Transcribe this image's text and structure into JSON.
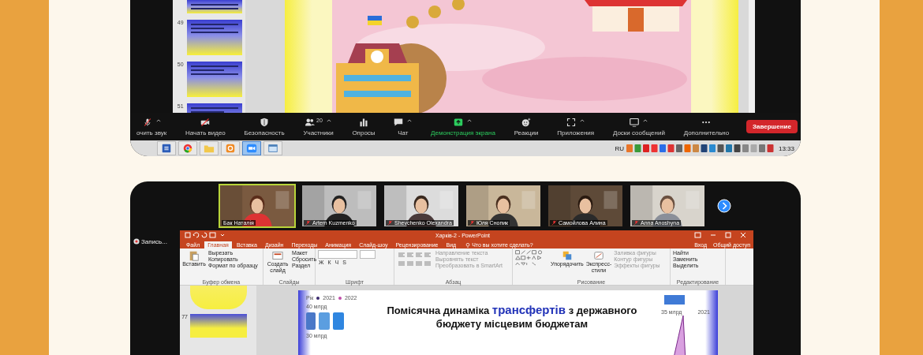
{
  "top_screen": {
    "thumbnails": [
      {
        "kind": "partial"
      },
      {
        "kind": "full",
        "number": "49"
      },
      {
        "kind": "full",
        "number": "50"
      },
      {
        "kind": "full",
        "number": "51"
      }
    ],
    "toolbar": [
      {
        "label": "очить звук",
        "kind": "mic-off",
        "has_menu": true
      },
      {
        "label": "Начать видео",
        "kind": "video-off",
        "has_menu": false
      },
      {
        "label": "Безопасность",
        "kind": "shield",
        "has_menu": false
      },
      {
        "label": "Участники",
        "kind": "people",
        "count": "20",
        "has_menu": true
      },
      {
        "label": "Опросы",
        "kind": "chart",
        "has_menu": false
      },
      {
        "label": "Чат",
        "kind": "chat",
        "has_menu": true
      },
      {
        "label": "Демонстрация экрана",
        "kind": "share",
        "has_menu": true
      },
      {
        "label": "Реакции",
        "kind": "reaction",
        "has_menu": false
      },
      {
        "label": "Приложения",
        "kind": "apps",
        "has_menu": true
      },
      {
        "label": "Доски сообщений",
        "kind": "board",
        "has_menu": true
      },
      {
        "label": "Дополнительно",
        "kind": "more",
        "has_menu": false
      }
    ],
    "end_button": "Завершение",
    "taskbar": {
      "apps": [
        {
          "kind": "word",
          "selected": false
        },
        {
          "kind": "chrome",
          "selected": false
        },
        {
          "kind": "folder",
          "selected": false
        },
        {
          "kind": "orange",
          "selected": false
        },
        {
          "kind": "zoom",
          "selected": true
        },
        {
          "kind": "window",
          "selected": false
        }
      ],
      "language": "RU",
      "time": "13:33"
    }
  },
  "bottom_screen": {
    "participants": [
      {
        "name": "Бак Наталія",
        "muted": false,
        "speaking": true
      },
      {
        "name": "Artem Kuzmenko",
        "muted": true,
        "speaking": false
      },
      {
        "name": "Shevchenko Olexandra",
        "muted": true,
        "speaking": false
      },
      {
        "name": "Юля Снопик",
        "muted": true,
        "speaking": false
      },
      {
        "name": "Самойлова Алина",
        "muted": true,
        "speaking": false
      },
      {
        "name": "Anna Anoshyna",
        "muted": true,
        "speaking": false
      }
    ],
    "recording": "Запись...",
    "powerpoint": {
      "title": "Харків-2 - PowerPoint",
      "tabs": [
        {
          "label": "Файл",
          "selected": false
        },
        {
          "label": "Главная",
          "selected": true
        },
        {
          "label": "Вставка",
          "selected": false
        },
        {
          "label": "Дизайн",
          "selected": false
        },
        {
          "label": "Переходы",
          "selected": false
        },
        {
          "label": "Анимация",
          "selected": false
        },
        {
          "label": "Слайд-шоу",
          "selected": false
        },
        {
          "label": "Рецензирование",
          "selected": false
        },
        {
          "label": "Вид",
          "selected": false
        }
      ],
      "search": "Что вы хотите сделать?",
      "sign_in": "Вход",
      "share": "Общий доступ",
      "groups": [
        {
          "kind": "commands",
          "label": "Буфер обмена",
          "big": [
            {
              "label": "Вставить",
              "kind": "paste"
            }
          ],
          "small": [
            "Вырезать",
            "Копировать",
            "Формат по образцу"
          ]
        },
        {
          "kind": "commands",
          "label": "Слайды",
          "big": [
            {
              "label": "Создать слайд",
              "kind": "slide"
            }
          ],
          "small": [
            "Макет",
            "Сбросить",
            "Раздел"
          ]
        },
        {
          "kind": "font",
          "label": "Шрифт",
          "small": [
            "Ж",
            "К",
            "Ч",
            "S"
          ]
        },
        {
          "kind": "paragraph",
          "label": "Абзац",
          "small": [
            "Направление текста",
            "Выровнять текст",
            "Преобразовать в SmartArt"
          ]
        },
        {
          "kind": "drawing",
          "label": "Рисование",
          "big": [
            {
              "label": "Упорядочить",
              "kind": "arrange"
            },
            {
              "label": "Экспресс-стили",
              "kind": "styles"
            }
          ],
          "small": [
            "Заливка фигуры",
            "Контур фигуры",
            "Эффекты фигуры"
          ]
        },
        {
          "kind": "commands",
          "label": "Редактирование",
          "small": [
            "Найти",
            "Заменить",
            "Выделить"
          ]
        }
      ],
      "slide_numbers": [
        "77"
      ],
      "slide": {
        "title": "Помісячна динаміка **трансфертів** з державного бюджету місцевим бюджетам",
        "legend_title": "Рік",
        "legend": [
          {
            "label": "2021",
            "color": "#3a2a6e"
          },
          {
            "label": "2022",
            "color": "#c04fa8"
          }
        ],
        "left_labels": [
          "40 млрд",
          "30 млрд"
        ],
        "right_labels": [
          "35 млрд",
          "2021"
        ]
      }
    }
  }
}
